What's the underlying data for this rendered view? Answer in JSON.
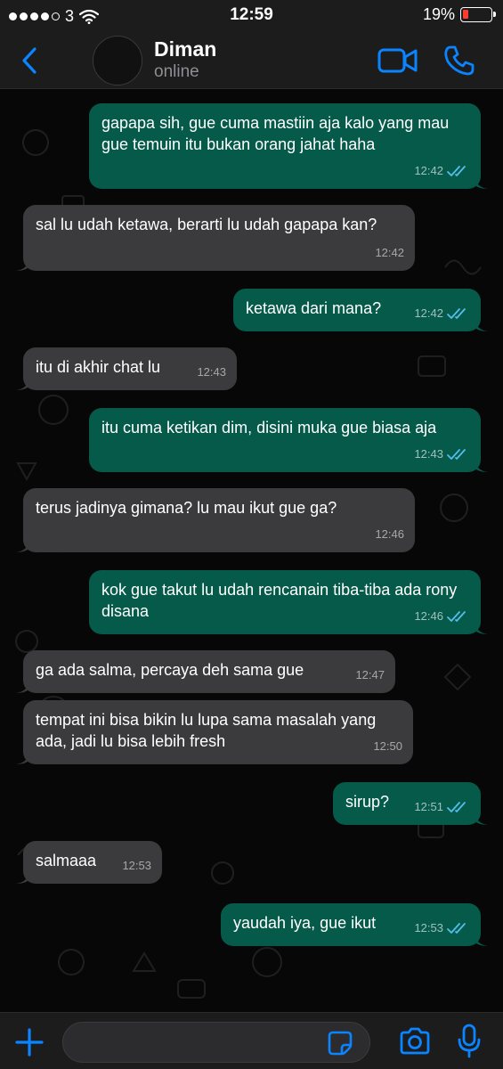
{
  "status_bar": {
    "carrier": "3",
    "time": "12:59",
    "battery": "19%",
    "battery_level": 0.19
  },
  "header": {
    "contact_name": "Diman",
    "contact_status": "online"
  },
  "messages": [
    {
      "dir": "out",
      "text": "gapapa sih, gue cuma mastiin aja kalo yang mau gue temuin itu bukan orang jahat haha",
      "time": "12:42"
    },
    {
      "dir": "in",
      "text": "sal lu udah ketawa, berarti lu udah gapapa kan?",
      "time": "12:42"
    },
    {
      "dir": "out",
      "text": "ketawa dari mana?",
      "time": "12:42"
    },
    {
      "dir": "in",
      "text": "itu di akhir chat lu",
      "time": "12:43"
    },
    {
      "dir": "out",
      "text": "itu cuma ketikan dim, disini muka gue biasa aja",
      "time": "12:43"
    },
    {
      "dir": "in",
      "text": "terus jadinya gimana? lu mau ikut gue ga?",
      "time": "12:46"
    },
    {
      "dir": "out",
      "text": "kok gue takut lu udah rencanain tiba-tiba ada rony disana",
      "time": "12:46"
    },
    {
      "dir": "in",
      "text": "ga ada salma, percaya deh sama gue",
      "time": "12:47"
    },
    {
      "dir": "in",
      "text": "tempat ini bisa bikin lu lupa sama masalah yang ada, jadi lu bisa lebih fresh",
      "time": "12:50"
    },
    {
      "dir": "out",
      "text": "sirup?",
      "time": "12:51"
    },
    {
      "dir": "in",
      "text": "salmaaa",
      "time": "12:53"
    },
    {
      "dir": "out",
      "text": "yaudah iya, gue ikut",
      "time": "12:53"
    }
  ],
  "input": {
    "value": "",
    "placeholder": ""
  },
  "icons": {
    "back": "chevron-left-icon",
    "video": "video-camera-icon",
    "call": "phone-icon",
    "attach": "plus-icon",
    "sticker": "sticker-icon",
    "camera": "camera-icon",
    "mic": "microphone-icon",
    "read": "double-check-icon"
  },
  "colors": {
    "accent": "#0a84ff",
    "outgoing_bubble": "#055a4a",
    "incoming_bubble": "#3b3b3d",
    "read_ticks": "#53bdeb",
    "battery_low": "#ff3b30"
  }
}
